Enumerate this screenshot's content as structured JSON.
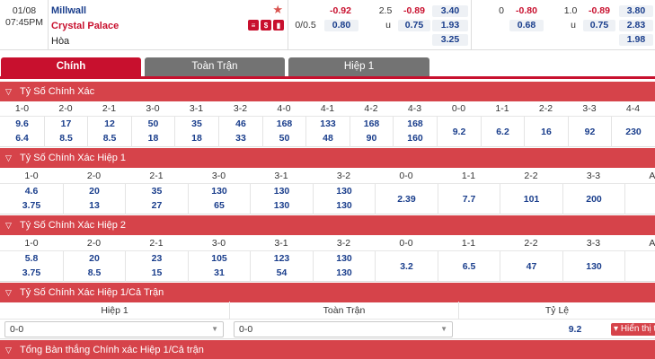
{
  "match": {
    "date": "01/08",
    "time": "07:45PM",
    "home": "Millwall",
    "away": "Crystal Palace",
    "draw": "Hòa",
    "odds_a": {
      "h_col1": "-0.92",
      "line_mid": "2.5",
      "h_col3": "-0.89",
      "h_col4": "3.40",
      "handicap": "0/0.5",
      "a_col1": "0.80",
      "u_label": "u",
      "a_col3": "0.75",
      "a_col4": "1.93",
      "d_col4": "3.25"
    },
    "odds_b": {
      "h_col0": "0",
      "h_col1": "-0.80",
      "line_mid": "1.0",
      "h_col3": "-0.89",
      "h_col4": "3.80",
      "a_col1": "0.68",
      "u_label": "u",
      "a_col3": "0.75",
      "a_col4": "2.83",
      "d_col4": "1.98"
    }
  },
  "tabs": [
    "Chính",
    "Toàn Trận",
    "Hiệp 1"
  ],
  "sections": {
    "exact": {
      "title": "Tỷ Số Chính Xác",
      "headers": [
        "1-0",
        "2-0",
        "2-1",
        "3-0",
        "3-1",
        "3-2",
        "4-0",
        "4-1",
        "4-2",
        "4-3",
        "0-0",
        "1-1",
        "2-2",
        "3-3",
        "4-4"
      ],
      "home": [
        "9.6",
        "17",
        "12",
        "50",
        "35",
        "46",
        "168",
        "133",
        "168",
        "168",
        "9.2",
        "6.2",
        "16",
        "92",
        "230"
      ],
      "away": [
        "6.4",
        "8.5",
        "8.5",
        "18",
        "18",
        "33",
        "50",
        "48",
        "90",
        "160",
        "",
        "",
        "",
        "",
        ""
      ]
    },
    "exact_h1": {
      "title": "Tỷ Số Chính Xác Hiệp 1",
      "headers": [
        "1-0",
        "2-0",
        "2-1",
        "3-0",
        "3-1",
        "3-2",
        "0-0",
        "1-1",
        "2-2",
        "3-3",
        "AO"
      ],
      "home": [
        "4.6",
        "20",
        "35",
        "130",
        "130",
        "130",
        "2.39",
        "7.7",
        "101",
        "200",
        ""
      ],
      "away": [
        "3.75",
        "13",
        "27",
        "65",
        "130",
        "130",
        "",
        "",
        "",
        "",
        ""
      ]
    },
    "exact_h2": {
      "title": "Tỷ Số Chính Xác Hiệp 2",
      "headers": [
        "1-0",
        "2-0",
        "2-1",
        "3-0",
        "3-1",
        "3-2",
        "0-0",
        "1-1",
        "2-2",
        "3-3",
        "AO"
      ],
      "home": [
        "5.8",
        "20",
        "23",
        "105",
        "123",
        "130",
        "3.2",
        "6.5",
        "47",
        "130",
        ""
      ],
      "away": [
        "3.75",
        "8.5",
        "15",
        "31",
        "54",
        "130",
        "",
        "",
        "",
        "",
        ""
      ]
    },
    "halffull": {
      "title": "Tỷ Số Chính Xác Hiệp 1/Cả Trận",
      "col_h1": "Hiệp 1",
      "col_ft": "Toàn Trận",
      "col_ratio": "Tỷ Lệ",
      "sel_h1": "0-0",
      "sel_ft": "0-0",
      "ratio": "9.2",
      "show_btn": "Hiển thị tất cả"
    },
    "total": {
      "title": "Tổng Bàn thắng Chính xác Hiệp 1/Cả trận"
    }
  },
  "colors": {
    "brand_red": "#c8102e",
    "section_red": "#d6434a",
    "value_blue": "#1a3e8c"
  }
}
